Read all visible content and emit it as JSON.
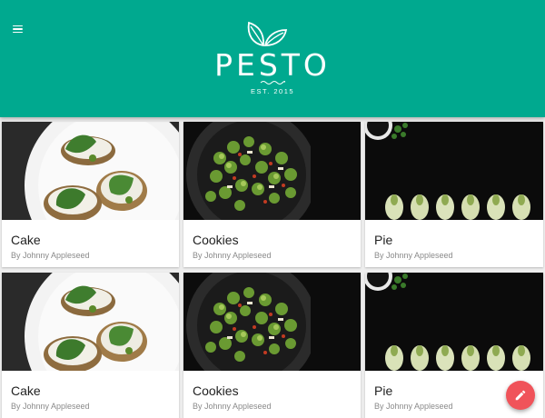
{
  "header": {
    "logo_text": "PESTO",
    "logo_subtext": "EST. 2015",
    "background_color": "#00a98f",
    "menu_icon": "hamburger-menu-icon"
  },
  "recipes": [
    {
      "title": "Cake",
      "author": "By Johnny Appleseed",
      "image": "bruschetta-basil-plate"
    },
    {
      "title": "Cookies",
      "author": "By Johnny Appleseed",
      "image": "brussels-sprouts-pan"
    },
    {
      "title": "Pie",
      "author": "By Johnny Appleseed",
      "image": "endive-row-dark"
    },
    {
      "title": "Cake",
      "author": "By Johnny Appleseed",
      "image": "bruschetta-basil-plate"
    },
    {
      "title": "Cookies",
      "author": "By Johnny Appleseed",
      "image": "brussels-sprouts-pan"
    },
    {
      "title": "Pie",
      "author": "By Johnny Appleseed",
      "image": "endive-row-dark"
    }
  ],
  "fab": {
    "icon": "pencil-edit-icon",
    "color": "#f0535a"
  }
}
